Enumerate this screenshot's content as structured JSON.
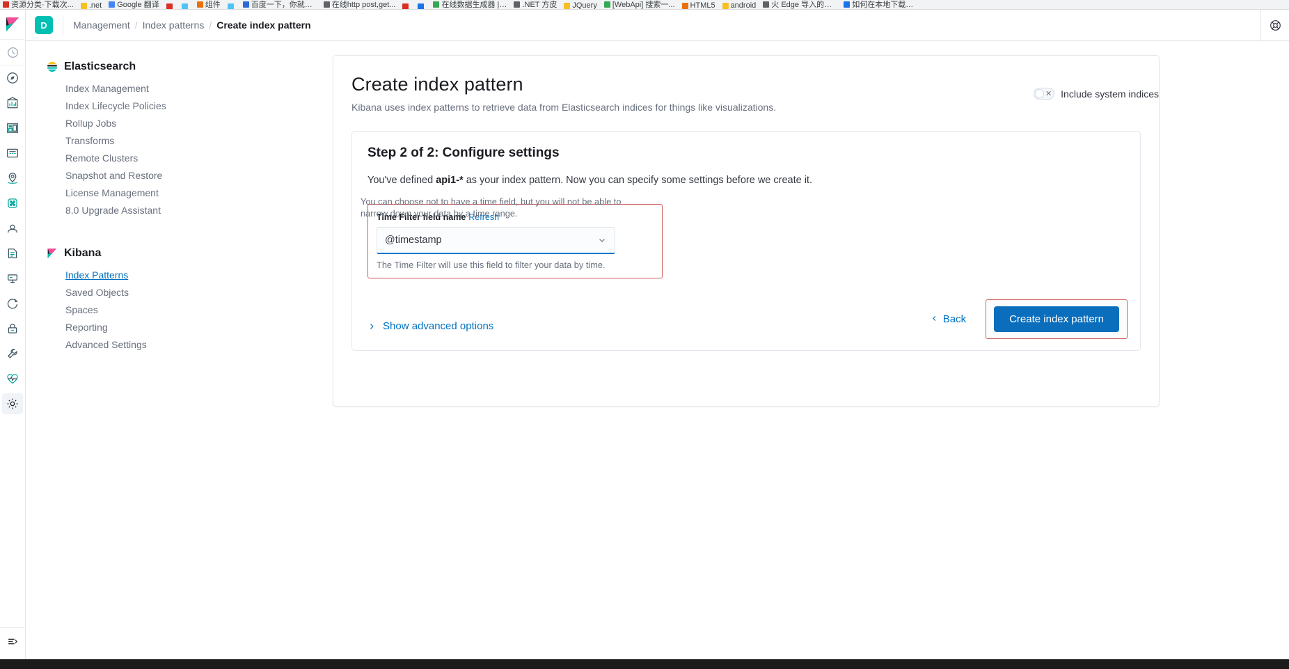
{
  "browser": {
    "bookmarks": [
      {
        "label": "资源分类·下载次...",
        "color": "#d93025"
      },
      {
        "label": ".net",
        "color": "#f6bf26"
      },
      {
        "label": "Google 翻译",
        "color": "#4285f4"
      },
      {
        "label": "",
        "color": "#d93025"
      },
      {
        "label": "",
        "color": "#4fc3f7"
      },
      {
        "label": "组件",
        "color": "#e8710a"
      },
      {
        "label": "",
        "color": "#4fc3f7"
      },
      {
        "label": "百度一下，你就知道",
        "color": "#2b6bd6"
      },
      {
        "label": "在线http post,get...",
        "color": "#5f6368"
      },
      {
        "label": "",
        "color": "#d93025"
      },
      {
        "label": "",
        "color": "#1a73e8"
      },
      {
        "label": "在线数据生成器 | R...",
        "color": "#34a853"
      },
      {
        "label": ".NET 方皮",
        "color": "#5f6368"
      },
      {
        "label": "JQuery",
        "color": "#f6bf26"
      },
      {
        "label": "[WebApi] 搜索一...",
        "color": "#34a853"
      },
      {
        "label": "HTML5",
        "color": "#e8710a"
      },
      {
        "label": "android",
        "color": "#f6bf26"
      },
      {
        "label": "火 Edge 导入的书签",
        "color": "#5f6368"
      },
      {
        "label": "如何在本地下载办...",
        "color": "#1a73e8"
      }
    ]
  },
  "header": {
    "space_avatar_letter": "D",
    "breadcrumbs": [
      {
        "label": "Management",
        "current": false
      },
      {
        "label": "Index patterns",
        "current": false
      },
      {
        "label": "Create index pattern",
        "current": true
      }
    ],
    "help_icon": "help-lifebuoy-icon"
  },
  "icon_rail": {
    "logo": "kibana-logo-icon",
    "items": [
      {
        "name": "recently-viewed-icon",
        "active": false
      },
      {
        "name": "discover-icon",
        "active": false
      },
      {
        "name": "visualize-icon",
        "active": false
      },
      {
        "name": "dashboard-icon",
        "active": false
      },
      {
        "name": "canvas-icon",
        "active": false
      },
      {
        "name": "maps-icon",
        "active": false
      },
      {
        "name": "machine-learning-icon",
        "active": false
      },
      {
        "name": "infrastructure-icon",
        "active": false
      },
      {
        "name": "logs-icon",
        "active": false
      },
      {
        "name": "apm-icon",
        "active": false
      },
      {
        "name": "uptime-icon",
        "active": false
      },
      {
        "name": "siem-icon",
        "active": false
      },
      {
        "name": "dev-tools-icon",
        "active": false
      },
      {
        "name": "monitoring-icon",
        "active": false
      },
      {
        "name": "management-gear-icon",
        "active": true
      }
    ],
    "bottom_item": {
      "name": "expand-nav-icon"
    }
  },
  "side_nav": {
    "groups": [
      {
        "title": "Elasticsearch",
        "logo": "elasticsearch-logo-icon",
        "items": [
          {
            "label": "Index Management",
            "active": false
          },
          {
            "label": "Index Lifecycle Policies",
            "active": false
          },
          {
            "label": "Rollup Jobs",
            "active": false
          },
          {
            "label": "Transforms",
            "active": false
          },
          {
            "label": "Remote Clusters",
            "active": false
          },
          {
            "label": "Snapshot and Restore",
            "active": false
          },
          {
            "label": "License Management",
            "active": false
          },
          {
            "label": "8.0 Upgrade Assistant",
            "active": false
          }
        ]
      },
      {
        "title": "Kibana",
        "logo": "kibana-logo-icon",
        "items": [
          {
            "label": "Index Patterns",
            "active": true
          },
          {
            "label": "Saved Objects",
            "active": false
          },
          {
            "label": "Spaces",
            "active": false
          },
          {
            "label": "Reporting",
            "active": false
          },
          {
            "label": "Advanced Settings",
            "active": false
          }
        ]
      }
    ]
  },
  "main": {
    "title": "Create index pattern",
    "subtitle": "Kibana uses index patterns to retrieve data from Elasticsearch indices for things like visualizations.",
    "system_indices": {
      "label": "Include system indices",
      "enabled": false,
      "off_glyph": "✕"
    },
    "step": {
      "title": "Step 2 of 2: Configure settings",
      "description_prefix": "You've defined ",
      "description_pattern": "api1-*",
      "description_suffix": " as your index pattern. Now you can specify some settings before we create it.",
      "time_filter": {
        "label": "Time Filter field name",
        "refresh_label": "Refresh",
        "selected_value": "@timestamp",
        "chevron_icon": "chevron-down-icon",
        "help_line_1": "The Time Filter will use this field to filter your data by time.",
        "help_line_2": "You can choose not to have a time field, but you will not be able to",
        "help_line_3": "narrow down your data by a time range."
      },
      "advanced_options_label": "Show advanced options",
      "advanced_chevron_icon": "chevron-right-icon",
      "back_label": "Back",
      "back_chevron_icon": "chevron-left-icon",
      "create_label": "Create index pattern"
    }
  },
  "colors": {
    "accent_blue": "#0071c2",
    "primary_button": "#0a6ebd",
    "annotation_red": "#d15c5c",
    "space_avatar": "#00bfb3"
  }
}
